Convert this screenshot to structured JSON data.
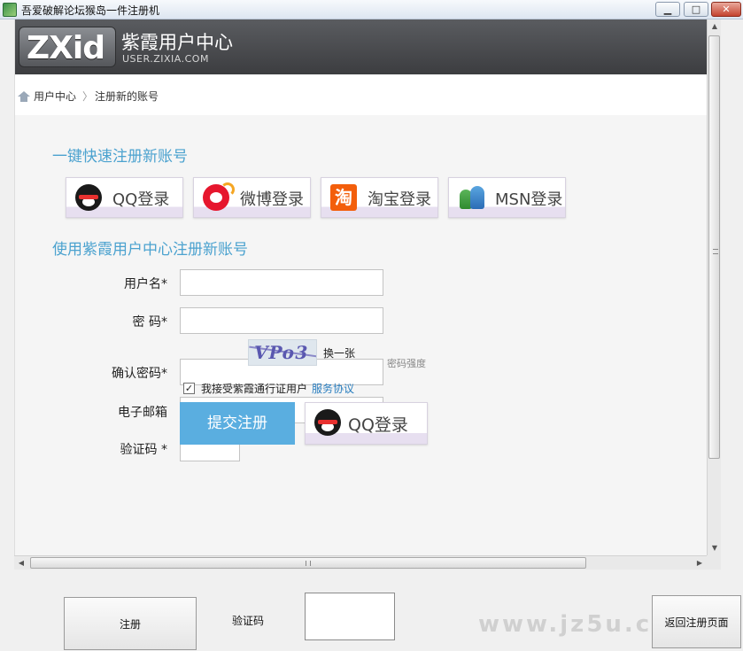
{
  "window": {
    "title": "吾爱破解论坛猴岛一件注册机",
    "minimize_glyph": "▁",
    "maximize_glyph": "□",
    "close_glyph": "✕"
  },
  "site": {
    "logo_text": "ZXid",
    "name": "紫霞用户中心",
    "url": "USER.ZIXIA.COM"
  },
  "breadcrumb": {
    "home": "用户中心",
    "separator": "〉",
    "current": "注册新的账号"
  },
  "quick_register": {
    "title": "一键快速注册新账号",
    "buttons": [
      {
        "label": "QQ登录",
        "icon": "qq-icon"
      },
      {
        "label": "微博登录",
        "icon": "weibo-icon"
      },
      {
        "label": "淘宝登录",
        "icon": "taobao-icon",
        "glyph": "淘"
      },
      {
        "label": "MSN登录",
        "icon": "msn-icon"
      }
    ]
  },
  "register_form": {
    "title": "使用紫霞用户中心注册新账号",
    "username_label": "用户名*",
    "password_label": "密  码*",
    "strength_label": "密码强度",
    "confirm_label": "确认密码*",
    "email_label": "电子邮箱",
    "captcha_label": "验证码 *",
    "captcha_text": "VPo3",
    "refresh_label": "换一张",
    "agree_check": "✓",
    "agree_text": "我接受紫霞通行证用户",
    "agree_link": "服务协议",
    "submit_label": "提交注册",
    "qq_login_label": "QQ登录"
  },
  "footer": {
    "register_label": "注册",
    "captcha_label": "验证码",
    "back_label": "返回注册页面",
    "watermark": "www.jz5u.com"
  },
  "scrollbar": {
    "up": "▲",
    "down": "▼",
    "left": "◀",
    "right": "▶"
  }
}
